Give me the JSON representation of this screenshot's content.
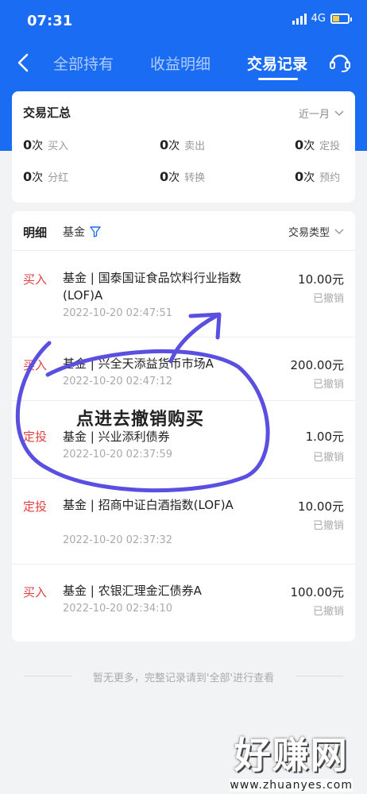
{
  "status_bar": {
    "time": "07:31",
    "network": "4G"
  },
  "nav": {
    "tabs": [
      {
        "label": "全部持有"
      },
      {
        "label": "收益明细"
      },
      {
        "label": "交易记录"
      }
    ]
  },
  "summary": {
    "title": "交易汇总",
    "period": "近一月",
    "unit": "次",
    "stats": [
      {
        "count": "0",
        "label": "买入"
      },
      {
        "count": "0",
        "label": "卖出"
      },
      {
        "count": "0",
        "label": "定投"
      },
      {
        "count": "0",
        "label": "分红"
      },
      {
        "count": "0",
        "label": "转换"
      },
      {
        "count": "0",
        "label": "预约"
      }
    ]
  },
  "detail": {
    "title": "明细",
    "filter_label": "基金",
    "type_filter_label": "交易类型",
    "rows": [
      {
        "type": "买入",
        "name": "基金 | 国泰国证食品饮料行业指数(LOF)A",
        "date": "2022-10-20 02:47:51",
        "amount": "10.00元",
        "status": "已撤销"
      },
      {
        "type": "买入",
        "name": "基金 | 兴全天添益货币市场A",
        "date": "2022-10-20 02:47:12",
        "amount": "200.00元",
        "status": "已撤销"
      },
      {
        "type": "定投",
        "name": "基金 | 兴业添利债券",
        "date": "2022-10-20 02:37:59",
        "amount": "1.00元",
        "status": "已撤销"
      },
      {
        "type": "定投",
        "name": "基金 | 招商中证白酒指数(LOF)A",
        "date": "2022-10-20 02:37:32",
        "amount": "10.00元",
        "status": "已撤销"
      },
      {
        "type": "买入",
        "name": "基金 | 农银汇理金汇债券A",
        "date": "2022-10-20 02:34:10",
        "amount": "100.00元",
        "status": "已撤销"
      }
    ]
  },
  "footer_note": "暂无更多，完整记录请到'全部'进行查看",
  "annotation_text": "点进去撤销购买",
  "watermark": {
    "brand": "好赚网",
    "url": "www.zhuanyes.com"
  },
  "colors": {
    "header": "#1a6cf2",
    "buy": "#e04040",
    "annotation": "#5a4fe0"
  }
}
